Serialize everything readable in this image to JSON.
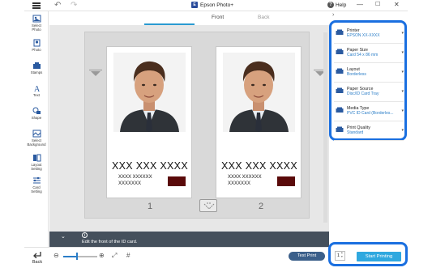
{
  "window": {
    "title": "Epson Photo+",
    "help": "Help",
    "logo_text": "E"
  },
  "tabs": [
    {
      "label": "Front"
    },
    {
      "label": "Back"
    }
  ],
  "toolbar": {
    "items": [
      {
        "label": "Select Photo",
        "lines": [
          "Select",
          "Photo"
        ]
      },
      {
        "label": "Photo",
        "lines": [
          "Photo"
        ]
      },
      {
        "label": "Stamps",
        "lines": [
          "Stamps"
        ]
      },
      {
        "label": "Text",
        "lines": [
          "Text"
        ]
      },
      {
        "label": "Shape",
        "lines": [
          "Shape"
        ]
      },
      {
        "label": "Select Background",
        "lines": [
          "Select",
          "Background"
        ]
      },
      {
        "label": "Layout Setting",
        "lines": [
          "Layout",
          "Setting"
        ]
      },
      {
        "label": "Card Setting",
        "lines": [
          "Card",
          "Setting"
        ]
      }
    ]
  },
  "cards": [
    {
      "name": "XXX XXX XXXX",
      "sub1": "XXXX XXXXXX",
      "sub2": "XXXXXXX",
      "number": "1"
    },
    {
      "name": "XXX XXX XXXX",
      "sub1": "XXXX XXXXXX",
      "sub2": "XXXXXXX",
      "number": "2"
    }
  ],
  "hint": {
    "text": "Edit the front of the ID card.",
    "info": "i"
  },
  "settings": [
    {
      "title": "Printer",
      "value": "EPSON XX-XXXX"
    },
    {
      "title": "Paper Size",
      "value": "Card 54 x 86 mm"
    },
    {
      "title": "Layout",
      "value": "Borderless"
    },
    {
      "title": "Paper Source",
      "value": "Disc/ID Card Tray"
    },
    {
      "title": "Media Type",
      "value": "PVC ID Card (Borderles..."
    },
    {
      "title": "Print Quality",
      "value": "Standard"
    }
  ],
  "bottom": {
    "back_label": "Back",
    "test_print": "Test Print",
    "copies": "1",
    "start_printing": "Start Printing",
    "zoom_level": 0.4
  },
  "colors": {
    "accent": "#2a9ad1",
    "highlight": "#1a6fe0",
    "card_block": "#5a0a0a"
  }
}
